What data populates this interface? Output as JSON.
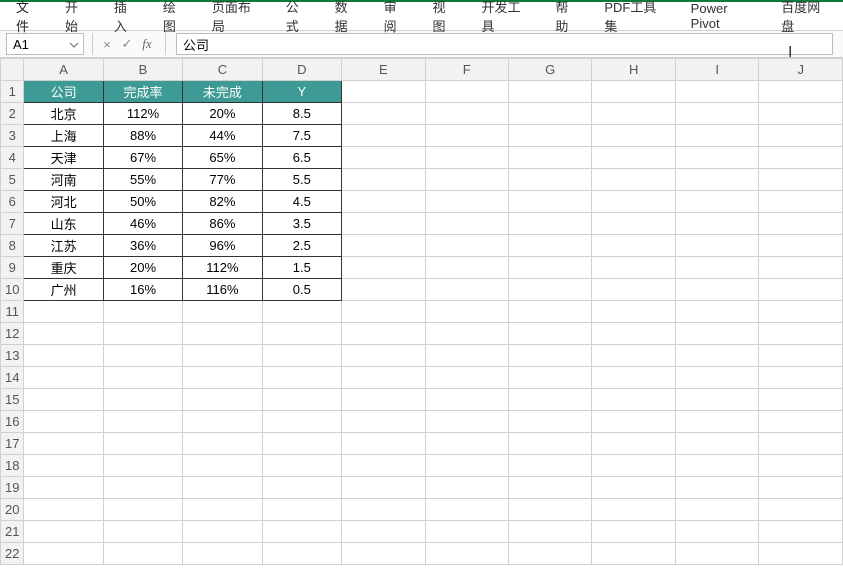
{
  "ribbon": {
    "tabs": [
      "文件",
      "开始",
      "插入",
      "绘图",
      "页面布局",
      "公式",
      "数据",
      "审阅",
      "视图",
      "开发工具",
      "帮助",
      "PDF工具集",
      "Power Pivot",
      "百度网盘"
    ]
  },
  "name_box": "A1",
  "formula_bar_value": "公司",
  "columns": [
    "A",
    "B",
    "C",
    "D",
    "E",
    "F",
    "G",
    "H",
    "I",
    "J"
  ],
  "header_row": [
    "公司",
    "完成率",
    "未完成",
    "Y"
  ],
  "data_rows": [
    [
      "北京",
      "112%",
      "20%",
      "8.5"
    ],
    [
      "上海",
      "88%",
      "44%",
      "7.5"
    ],
    [
      "天津",
      "67%",
      "65%",
      "6.5"
    ],
    [
      "河南",
      "55%",
      "77%",
      "5.5"
    ],
    [
      "河北",
      "50%",
      "82%",
      "4.5"
    ],
    [
      "山东",
      "46%",
      "86%",
      "3.5"
    ],
    [
      "江苏",
      "36%",
      "96%",
      "2.5"
    ],
    [
      "重庆",
      "20%",
      "112%",
      "1.5"
    ],
    [
      "广州",
      "16%",
      "116%",
      "0.5"
    ]
  ],
  "visible_row_count": 22,
  "caret_glyph": "I"
}
